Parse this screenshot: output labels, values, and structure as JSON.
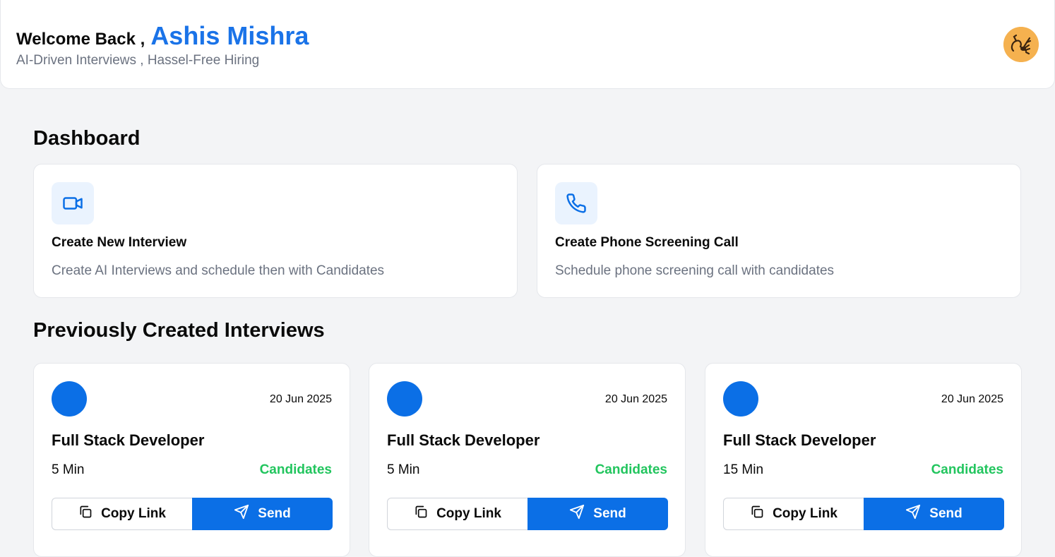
{
  "header": {
    "welcome": "Welcome Back ,",
    "user_name": "Ashis Mishra",
    "tagline": "AI-Driven Interviews , Hassel-Free Hiring",
    "avatar_icon": "scorpion-avatar-icon"
  },
  "dashboard": {
    "title": "Dashboard",
    "cards": [
      {
        "icon": "video-icon",
        "title": "Create New Interview",
        "description": "Create AI Interviews and schedule then with Candidates"
      },
      {
        "icon": "phone-icon",
        "title": "Create Phone Screening Call",
        "description": "Schedule phone screening call with candidates"
      }
    ]
  },
  "previous": {
    "title": "Previously Created Interviews",
    "interviews": [
      {
        "date": "20 Jun 2025",
        "title": "Full Stack Developer",
        "duration": "5 Min",
        "candidates_label": "Candidates",
        "copy_label": "Copy Link",
        "send_label": "Send"
      },
      {
        "date": "20 Jun 2025",
        "title": "Full Stack Developer",
        "duration": "5 Min",
        "candidates_label": "Candidates",
        "copy_label": "Copy Link",
        "send_label": "Send"
      },
      {
        "date": "20 Jun 2025",
        "title": "Full Stack Developer",
        "duration": "15 Min",
        "candidates_label": "Candidates",
        "copy_label": "Copy Link",
        "send_label": "Send"
      }
    ]
  },
  "colors": {
    "brand_blue": "#0b6fe6",
    "name_blue": "#1a73e8",
    "candidates_green": "#22c55e",
    "background": "#f3f4f6"
  }
}
